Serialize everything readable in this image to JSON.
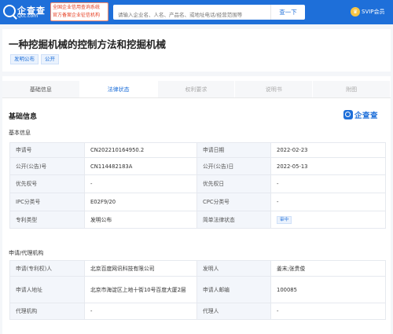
{
  "header": {
    "logo_text": "企查查",
    "logo_domain": "Qcc.com",
    "badge_line1": "全国企业信用查询系统",
    "badge_line2": "官方备案企业征信机构",
    "search_placeholder": "请输入企业名、人名、产品名、或地址电话/经营范围等",
    "search_button": "查一下",
    "svip_label": "SVIP会员"
  },
  "patent": {
    "title": "一种挖掘机械的控制方法和挖掘机械",
    "tags": [
      "发明公布",
      "公开"
    ]
  },
  "tabs": [
    {
      "label": "基础信息",
      "state": "normal"
    },
    {
      "label": "法律状态",
      "state": "active"
    },
    {
      "label": "权利要求",
      "state": "disabled"
    },
    {
      "label": "说明书",
      "state": "disabled"
    },
    {
      "label": "附图",
      "state": "disabled"
    }
  ],
  "section": {
    "title": "基础信息",
    "brand": "企查查",
    "basic_title": "基本信息",
    "agency_title": "申请/代理机构"
  },
  "basic_rows": [
    {
      "l1": "申请号",
      "v1": "CN202210164950.2",
      "l2": "申请日期",
      "v2": "2022-02-23"
    },
    {
      "l1": "公开(公告)号",
      "v1": "CN114482183A",
      "l2": "公开(公告)日",
      "v2": "2022-05-13"
    },
    {
      "l1": "优先权号",
      "v1": "-",
      "l2": "优先权日",
      "v2": "-"
    },
    {
      "l1": "IPC分类号",
      "v1": "E02F9/20",
      "l2": "CPC分类号",
      "v2": "-"
    },
    {
      "l1": "专利类型",
      "v1": "发明公布",
      "l2": "简单法律状态",
      "v2": "审中"
    }
  ],
  "agency_rows": [
    {
      "l1": "申请(专利权)人",
      "v1": "北京百度网讯科技有限公司",
      "l2": "发明人",
      "v2": "姜末;张贵俊"
    },
    {
      "l1": "申请人地址",
      "v1": "北京市海淀区上地十街10号百度大厦2层",
      "l2": "申请人邮编",
      "v2": "100085"
    },
    {
      "l1": "代理机构",
      "v1": "-",
      "l2": "代理人",
      "v2": "-"
    }
  ],
  "colors": {
    "brand_blue": "#1e6fd9",
    "badge_red": "#e53b1d",
    "svip_gold": "#f7c544"
  }
}
